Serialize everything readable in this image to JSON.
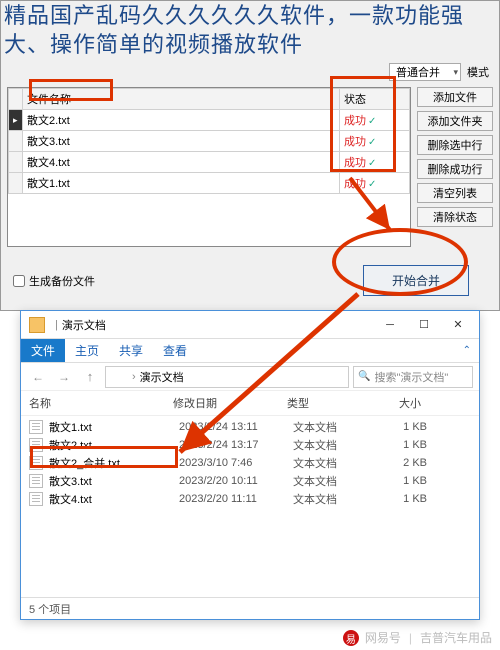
{
  "overlay_title": "精品国产乱码久久久久久久软件，一款功能强大、操作简单的视频播放软件",
  "merge_app": {
    "mode_combo": "普通合并",
    "mode_label": "模式",
    "table": {
      "col_filename": "文件名称",
      "col_status": "状态",
      "rows": [
        {
          "name": "散文2.txt",
          "status": "成功"
        },
        {
          "name": "散文3.txt",
          "status": "成功"
        },
        {
          "name": "散文4.txt",
          "status": "成功"
        },
        {
          "name": "散文1.txt",
          "status": "成功"
        }
      ]
    },
    "buttons": {
      "add_file": "添加文件",
      "add_folder": "添加文件夹",
      "remove_selected": "删除选中行",
      "remove_success": "删除成功行",
      "clear_list": "清空列表",
      "clear_status": "清除状态"
    },
    "backup_checkbox": "生成备份文件",
    "start_button": "开始合并"
  },
  "explorer": {
    "window_title": "演示文档",
    "ribbon": {
      "file": "文件",
      "home": "主页",
      "share": "共享",
      "view": "查看"
    },
    "breadcrumb": {
      "folder": "演示文档"
    },
    "search_placeholder": "搜索\"演示文档\"",
    "columns": {
      "name": "名称",
      "modified": "修改日期",
      "type": "类型",
      "size": "大小"
    },
    "files": [
      {
        "name": "散文1.txt",
        "date": "2023/2/24 13:11",
        "type": "文本文档",
        "size": "1 KB"
      },
      {
        "name": "散文2.txt",
        "date": "2023/2/24 13:17",
        "type": "文本文档",
        "size": "1 KB"
      },
      {
        "name": "散文2_合并.txt",
        "date": "2023/3/10 7:46",
        "type": "文本文档",
        "size": "2 KB",
        "highlighted": true
      },
      {
        "name": "散文3.txt",
        "date": "2023/2/20 10:11",
        "type": "文本文档",
        "size": "1 KB"
      },
      {
        "name": "散文4.txt",
        "date": "2023/2/20 11:11",
        "type": "文本文档",
        "size": "1 KB"
      }
    ],
    "status_text": "5 个项目"
  },
  "watermark": {
    "brand": "网易号",
    "author": "吉普汽车用品"
  }
}
